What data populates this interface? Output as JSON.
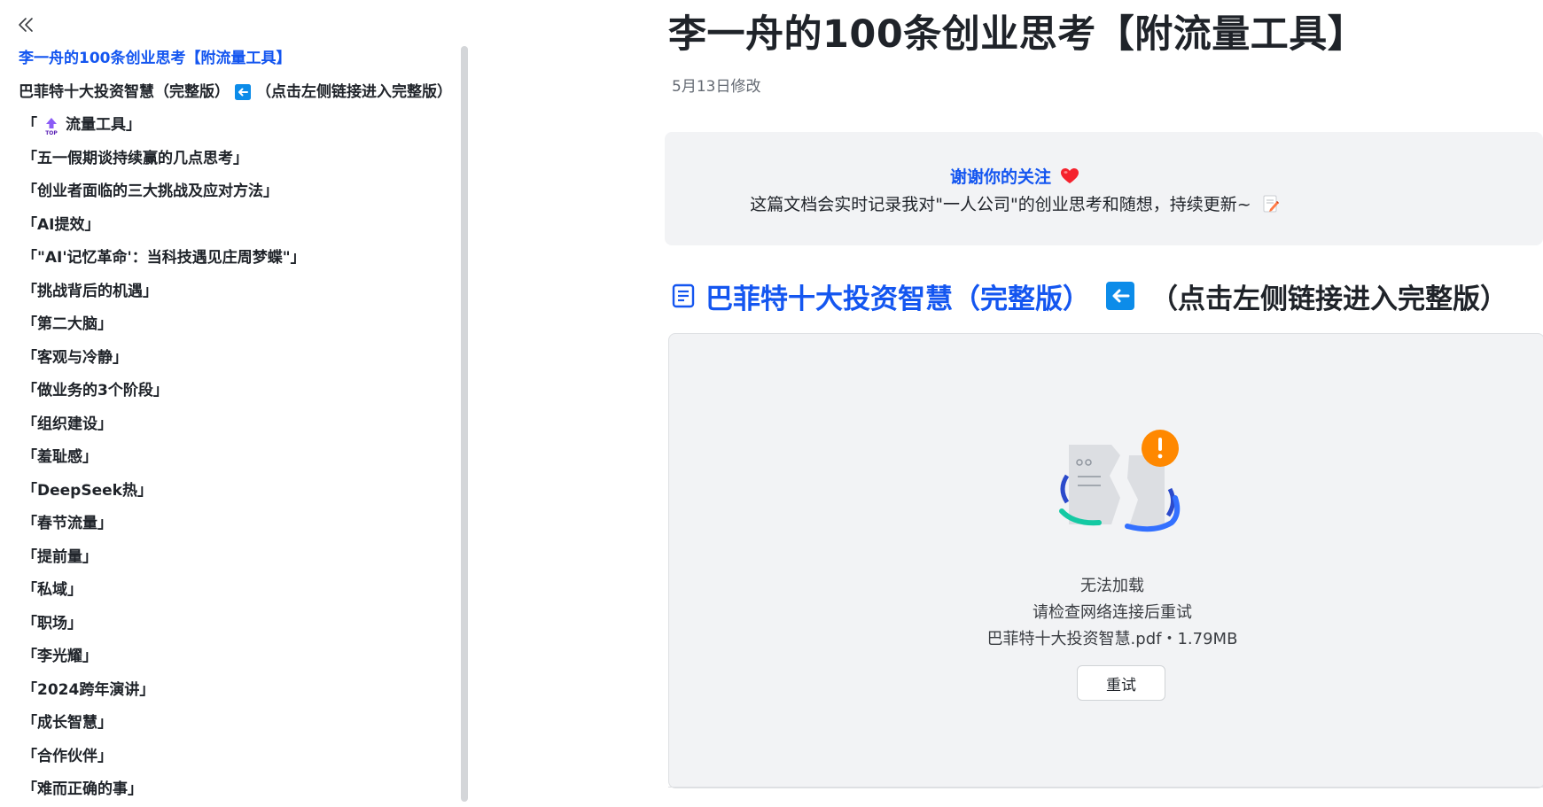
{
  "sidebar": {
    "collapse_glyph": "«",
    "items": [
      {
        "label": "李一舟的100条创业思考【附流量工具】",
        "level": 1,
        "active": true
      },
      {
        "label": "巴菲特十大投资智慧（完整版）",
        "suffix": "（点击左侧链接进入完整版）",
        "level": 1,
        "icon": "left-arrow-icon"
      },
      {
        "label": "「",
        "suffix": "流量工具」",
        "level": 2,
        "icon": "top-icon"
      },
      {
        "label": "「五一假期谈持续赢的几点思考」",
        "level": 2
      },
      {
        "label": "「创业者面临的三大挑战及应对方法」",
        "level": 2
      },
      {
        "label": "「AI提效」",
        "level": 2
      },
      {
        "label": "「\"AI'记忆革命'：当科技遇见庄周梦蝶\"」",
        "level": 2
      },
      {
        "label": "「挑战背后的机遇」",
        "level": 2
      },
      {
        "label": "「第二大脑」",
        "level": 2
      },
      {
        "label": "「客观与冷静」",
        "level": 2
      },
      {
        "label": "「做业务的3个阶段」",
        "level": 2
      },
      {
        "label": "「组织建设」",
        "level": 2
      },
      {
        "label": "「羞耻感」",
        "level": 2
      },
      {
        "label": "「DeepSeek热」",
        "level": 2
      },
      {
        "label": "「春节流量」",
        "level": 2
      },
      {
        "label": "「提前量」",
        "level": 2
      },
      {
        "label": "「私域」",
        "level": 2
      },
      {
        "label": "「职场」",
        "level": 2
      },
      {
        "label": "「李光耀」",
        "level": 2
      },
      {
        "label": "「2024跨年演讲」",
        "level": 2
      },
      {
        "label": "「成长智慧」",
        "level": 2
      },
      {
        "label": "「合作伙伴」",
        "level": 2
      },
      {
        "label": "「难而正确的事」",
        "level": 2
      }
    ]
  },
  "document": {
    "title": "李一舟的100条创业思考【附流量工具】",
    "modified": "5月13日修改",
    "callout": {
      "title": "谢谢你的关注",
      "text": "这篇文档会实时记录我对\"一人公司\"的创业思考和随想，持续更新~"
    },
    "section_heading": {
      "main": "巴菲特十大投资智慧（完整版）",
      "suffix": "（点击左侧链接进入完整版）"
    },
    "file_card": {
      "error_title": "无法加载",
      "error_sub": "请检查网络连接后重试",
      "file_info": "巴菲特十大投资智慧.pdf・1.79MB",
      "retry_label": "重试"
    }
  },
  "colors": {
    "accent": "#1456f0",
    "arrow_badge": "#0c8ce9",
    "warning": "#ff8800",
    "heart": "#f5222d"
  }
}
